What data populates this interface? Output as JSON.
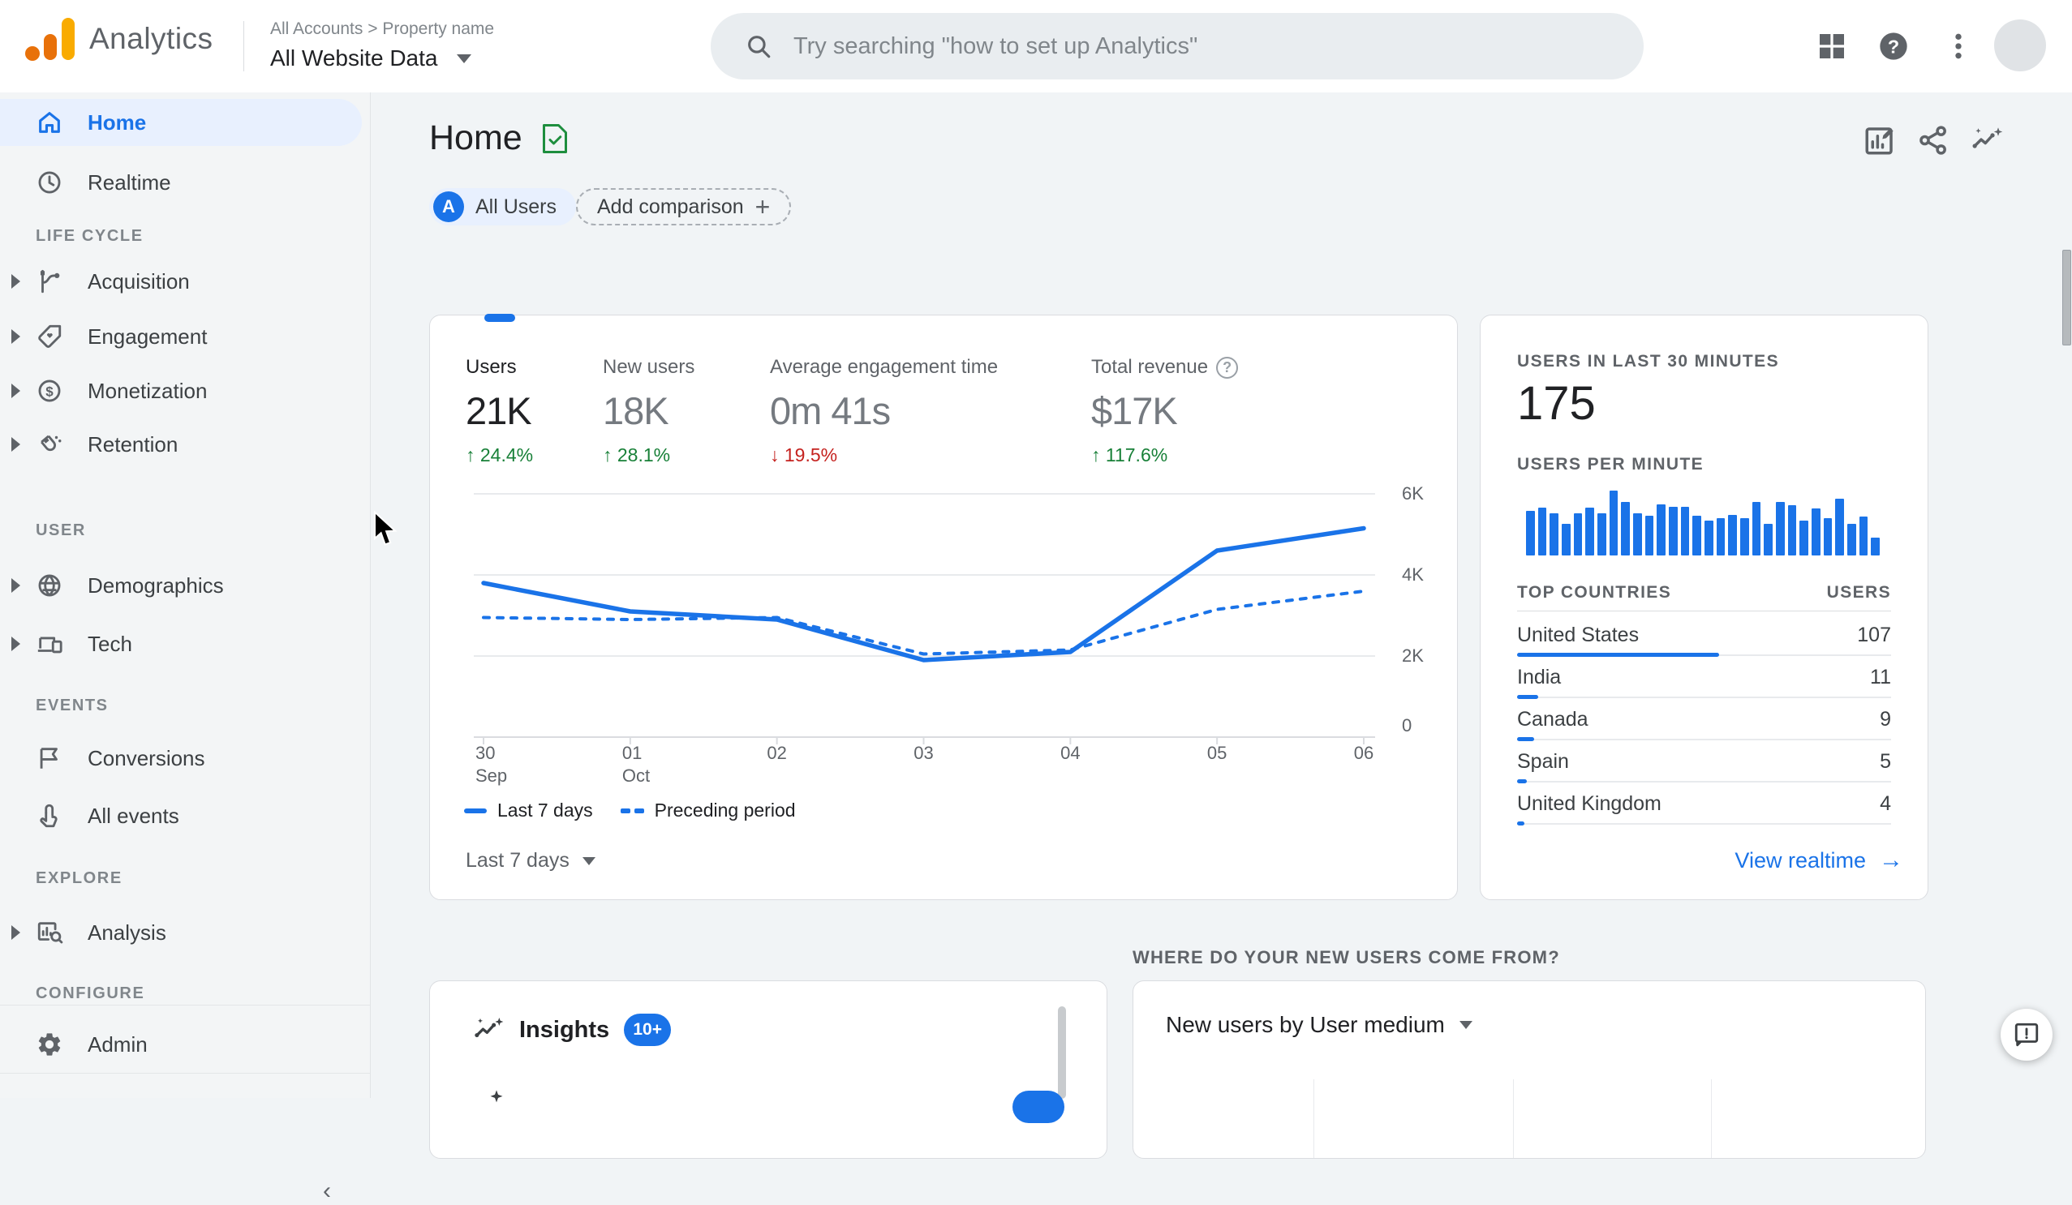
{
  "header": {
    "product_name": "Analytics",
    "breadcrumb_top": "All Accounts  >  Property name",
    "account_selector": "All Website Data",
    "search_placeholder": "Try searching \"how to set up Analytics\""
  },
  "sidebar": {
    "items": [
      {
        "label": "Home",
        "selected": true
      },
      {
        "label": "Realtime"
      },
      {
        "label": "LIFE CYCLE",
        "type": "header"
      },
      {
        "label": "Acquisition",
        "expandable": true
      },
      {
        "label": "Engagement",
        "expandable": true
      },
      {
        "label": "Monetization",
        "expandable": true
      },
      {
        "label": "Retention",
        "expandable": true
      },
      {
        "label": "USER",
        "type": "header"
      },
      {
        "label": "Demographics",
        "expandable": true
      },
      {
        "label": "Tech",
        "expandable": true
      },
      {
        "label": "EVENTS",
        "type": "header"
      },
      {
        "label": "Conversions"
      },
      {
        "label": "All events"
      },
      {
        "label": "EXPLORE",
        "type": "header"
      },
      {
        "label": "Analysis",
        "expandable": true
      },
      {
        "label": "CONFIGURE",
        "type": "header"
      },
      {
        "label": "Admin"
      }
    ]
  },
  "page": {
    "title": "Home"
  },
  "audience": {
    "all_users_avatar": "A",
    "all_users_label": "All Users",
    "add_comparison_label": "Add comparison",
    "plus_glyph": "+"
  },
  "overview_card": {
    "metrics": [
      {
        "label": "Users",
        "value": "21K",
        "delta": "24.4%",
        "direction": "up",
        "emphasis": true
      },
      {
        "label": "New users",
        "value": "18K",
        "delta": "28.1%",
        "direction": "up"
      },
      {
        "label": "Average engagement time",
        "value": "0m 41s",
        "delta": "19.5%",
        "direction": "down"
      },
      {
        "label": "Total revenue",
        "value": "$17K",
        "delta": "117.6%",
        "direction": "up",
        "has_help": true
      }
    ],
    "legend": [
      {
        "label": "Last 7 days",
        "style": "solid"
      },
      {
        "label": "Preceding period",
        "style": "dashed"
      }
    ],
    "range_selector": "Last 7 days"
  },
  "chart_data": [
    {
      "type": "line",
      "title": "Users over time (Last 7 days vs Preceding period)",
      "categories": [
        "30 Sep",
        "01 Oct",
        "02",
        "03",
        "04",
        "05",
        "06"
      ],
      "series": [
        {
          "name": "Last 7 days",
          "style": "solid",
          "values": [
            3800,
            3100,
            2900,
            1900,
            2100,
            4600,
            5150
          ]
        },
        {
          "name": "Preceding period",
          "style": "dashed",
          "values": [
            2950,
            2900,
            2950,
            2050,
            2150,
            3150,
            3600
          ]
        }
      ],
      "ylim": [
        0,
        6000
      ],
      "yticks": [
        "6K",
        "4K",
        "2K",
        "0"
      ],
      "grid": true,
      "legend_position": "bottom-left",
      "line_color": "#1a73e8"
    },
    {
      "type": "bar",
      "title": "USERS PER MINUTE",
      "values_pct": [
        69,
        74,
        65,
        49,
        65,
        74,
        65,
        100,
        83,
        65,
        61,
        79,
        75,
        75,
        61,
        54,
        58,
        62,
        58,
        83,
        49,
        82,
        78,
        54,
        72,
        57,
        88,
        49,
        60,
        27
      ],
      "bar_color": "#1a73e8"
    }
  ],
  "realtime_card": {
    "users_30min_label": "USERS IN LAST 30 MINUTES",
    "users_30min_value": "175",
    "users_per_minute_label": "USERS PER MINUTE",
    "top_countries_label": "TOP COUNTRIES",
    "users_col_label": "USERS",
    "countries": [
      {
        "name": "United States",
        "users": "107"
      },
      {
        "name": "India",
        "users": "11"
      },
      {
        "name": "Canada",
        "users": "9"
      },
      {
        "name": "Spain",
        "users": "5"
      },
      {
        "name": "United Kingdom",
        "users": "4"
      }
    ],
    "max_bar_pct": 54,
    "view_realtime_label": "View realtime",
    "view_realtime_arrow": "→"
  },
  "insights_card": {
    "title": "Insights",
    "badge": "10+"
  },
  "new_users_section": {
    "heading": "WHERE DO YOUR NEW USERS COME FROM?",
    "card_title": "New users by User medium"
  },
  "colors": {
    "accent_blue": "#1a73e8",
    "positive_green": "#188038",
    "negative_red": "#c5221f",
    "selected_pill_bg": "#e8f0fe",
    "logo_amber": "#f9ab00",
    "logo_orange": "#e8710a"
  }
}
